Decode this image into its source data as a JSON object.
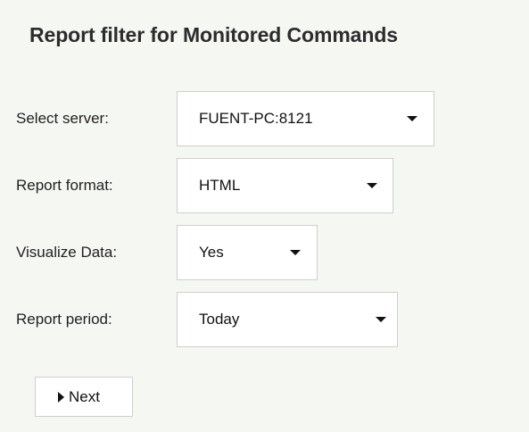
{
  "page": {
    "title": "Report filter for Monitored Commands"
  },
  "fields": {
    "server": {
      "label": "Select server:",
      "value": "FUENT-PC:8121"
    },
    "format": {
      "label": "Report format:",
      "value": "HTML"
    },
    "visualize": {
      "label": "Visualize Data:",
      "value": "Yes"
    },
    "period": {
      "label": "Report period:",
      "value": "Today"
    }
  },
  "actions": {
    "next_label": "Next",
    "next_icon": "play-triangle-icon"
  },
  "colors": {
    "background": "#f5f7f3",
    "control_border": "#cfcfcf",
    "control_bg": "#ffffff"
  }
}
